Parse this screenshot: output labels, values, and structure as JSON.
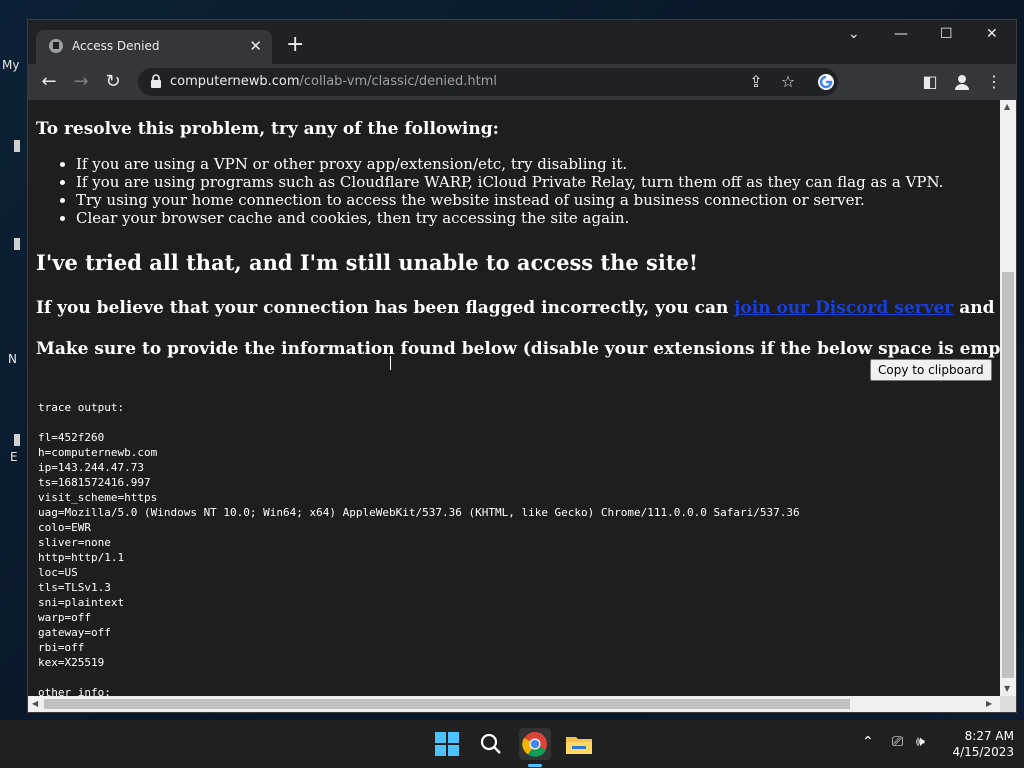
{
  "desktop": {
    "labels": [
      "My",
      "N",
      "E"
    ]
  },
  "browser": {
    "tab_title": "Access Denied",
    "url_host": "computernewb.com",
    "url_path": "/collab-vm/classic/denied.html"
  },
  "page": {
    "resolve_heading": "To resolve this problem, try any of the following:",
    "tips": [
      "If you are using a VPN or other proxy app/extension/etc, try disabling it.",
      "If you are using programs such as Cloudflare WARP, iCloud Private Relay, turn them off as they can flag as a VPN.",
      "Try using your home connection to access the website instead of using a business connection or server.",
      "Clear your browser cache and cookies, then try accessing the site again."
    ],
    "tried_heading": "I've tried all that, and I'm still unable to access the site!",
    "flagged_prefix": "If you believe that your connection has been flagged incorrectly, you can ",
    "discord_link": "join our Discord server",
    "flagged_suffix": " and open a ticket.",
    "provide_info": "Make sure to provide the information found below (disable your extensions if the below space is empty):",
    "copy_button": "Copy to clipboard",
    "trace": "trace output:\n\nfl=452f260\nh=computernewb.com\nip=143.244.47.73\nts=1681572416.997\nvisit_scheme=https\nuag=Mozilla/5.0 (Windows NT 10.0; Win64; x64) AppleWebKit/537.36 (KHTML, like Gecko) Chrome/111.0.0.0 Safari/537.36\ncolo=EWR\nsliver=none\nhttp=http/1.1\nloc=US\ntls=TLSv1.3\nsni=plaintext\nwarp=off\ngateway=off\nrbi=off\nkex=X25519\n\nother info:"
  },
  "taskbar": {
    "time": "8:27 AM",
    "date": "4/15/2023"
  },
  "colors": {
    "page_bg": "#1e1e1e",
    "link": "#1a3fd6",
    "chrome_dark": "#202124",
    "chrome_toolbar": "#35363a"
  }
}
